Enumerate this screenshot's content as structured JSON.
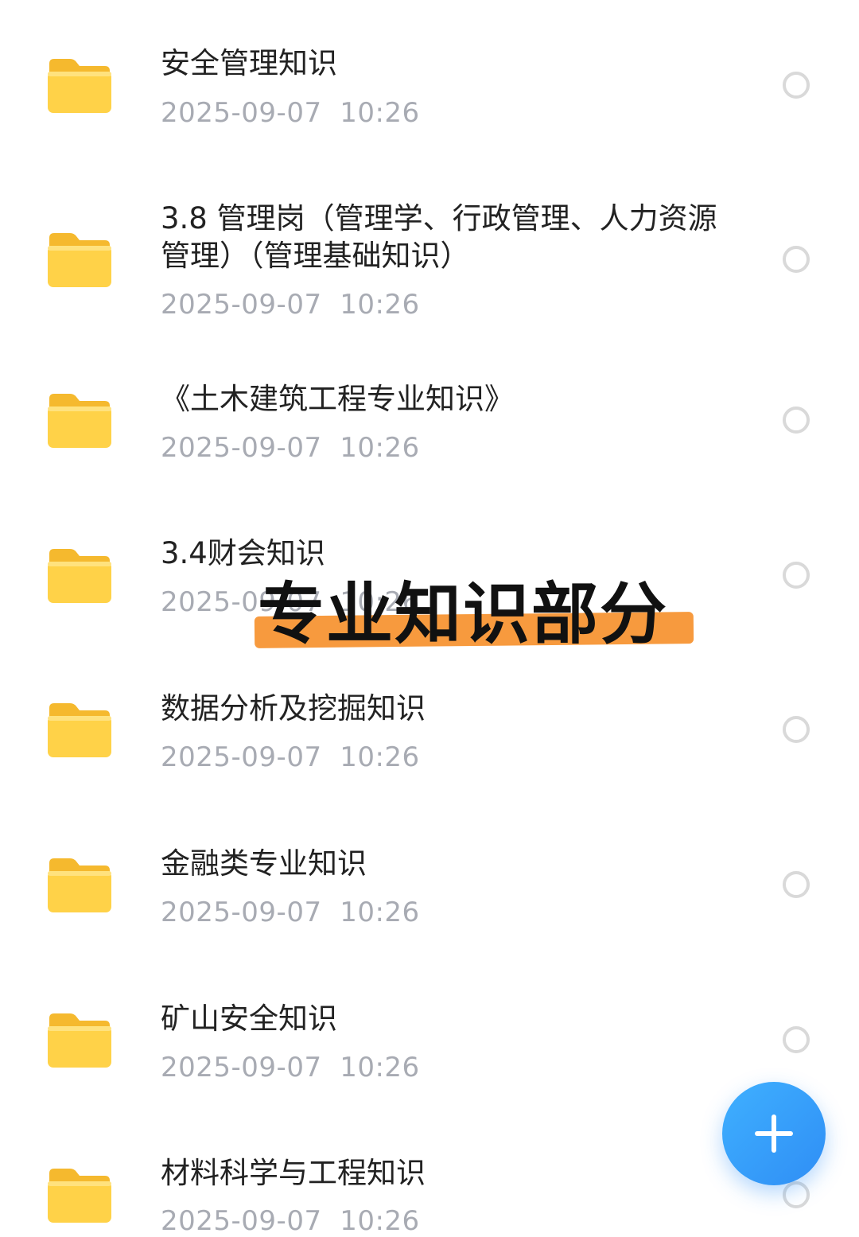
{
  "files": [
    {
      "name": "安全管理知识",
      "date": "2025-09-07  10:26"
    },
    {
      "name": "3.8 管理岗（管理学、行政管理、人力资源管理）（管理基础知识）",
      "date": "2025-09-07  10:26"
    },
    {
      "name": "《土木建筑工程专业知识》",
      "date": "2025-09-07  10:26"
    },
    {
      "name": "3.4财会知识",
      "date": "2025-09-07  10:26"
    },
    {
      "name": "数据分析及挖掘知识",
      "date": "2025-09-07  10:26"
    },
    {
      "name": "金融类专业知识",
      "date": "2025-09-07  10:26"
    },
    {
      "name": "矿山安全知识",
      "date": "2025-09-07  10:26"
    },
    {
      "name": "材料科学与工程知识",
      "date": "2025-09-07  10:26"
    }
  ],
  "overlay": {
    "text": "专业知识部分"
  },
  "icons": {
    "row": "folder-icon",
    "select": "radio-unchecked-icon",
    "fab": "plus-icon"
  },
  "colors": {
    "folder": "#ffd248",
    "folder_tab": "#f5b92e",
    "date_text": "#a8abb3",
    "highlight": "#f79a3e",
    "fab": "#2f8ef5"
  }
}
